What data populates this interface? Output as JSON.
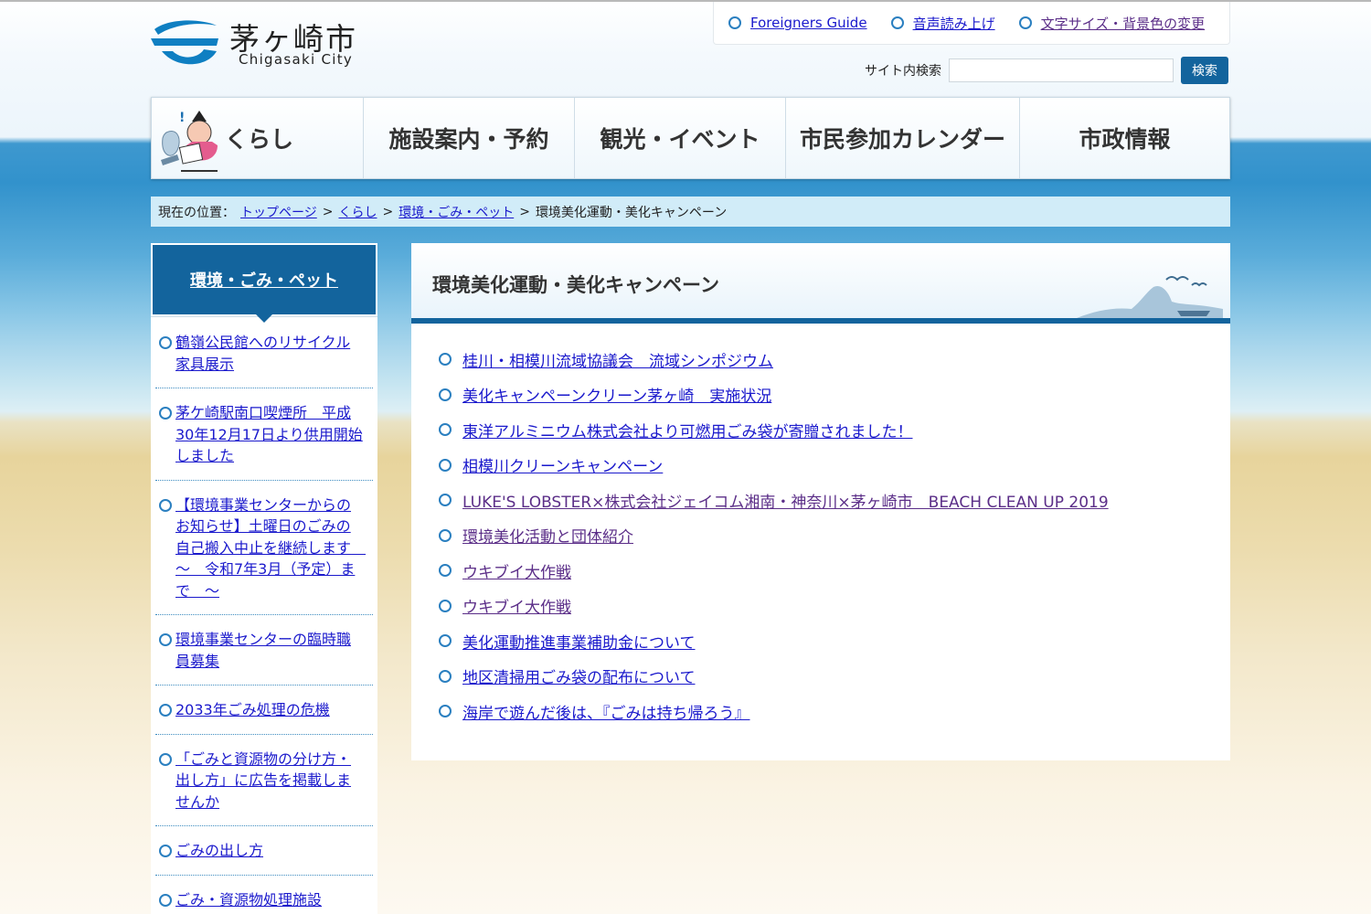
{
  "header": {
    "city_name_ja": "茅ヶ崎市",
    "city_name_en": "Chigasaki City",
    "utility_links": [
      {
        "label": "Foreigners Guide"
      },
      {
        "label": "音声読み上げ"
      },
      {
        "label": "文字サイズ・背景色の変更"
      }
    ],
    "search": {
      "label": "サイト内検索",
      "value": "",
      "button": "検索"
    }
  },
  "nav": {
    "items": [
      {
        "label": "くらし"
      },
      {
        "label": "施設案内・予約"
      },
      {
        "label": "観光・イベント"
      },
      {
        "label": "市民参加カレンダー"
      },
      {
        "label": "市政情報"
      }
    ]
  },
  "breadcrumb": {
    "prefix": "現在の位置：",
    "separator": ">",
    "links": [
      "トップページ",
      "くらし",
      "環境・ごみ・ペット"
    ],
    "current": "環境美化運動・美化キャンペーン"
  },
  "sidebar": {
    "heading": "環境・ごみ・ペット",
    "items": [
      {
        "label": "鶴嶺公民館へのリサイクル家具展示"
      },
      {
        "label": "茅ケ崎駅南口喫煙所　平成30年12月17日より供用開始しました"
      },
      {
        "label": "【環境事業センターからのお知らせ】土曜日のごみの自己搬入中止を継続します　～　令和7年3月（予定）まで　～"
      },
      {
        "label": "環境事業センターの臨時職員募集"
      },
      {
        "label": "2033年ごみ処理の危機"
      },
      {
        "label": "「ごみと資源物の分け方・出し方」に広告を掲載しませんか"
      },
      {
        "label": "ごみの出し方"
      },
      {
        "label": "ごみ・資源物処理施設"
      }
    ]
  },
  "main": {
    "title": "環境美化運動・美化キャンペーン",
    "links": [
      {
        "label": "桂川・相模川流域協議会　流域シンポジウム",
        "visited": false
      },
      {
        "label": "美化キャンペーンクリーン茅ヶ崎　実施状況",
        "visited": false
      },
      {
        "label": "東洋アルミニウム株式会社より可燃用ごみ袋が寄贈されました！",
        "visited": false
      },
      {
        "label": "相模川クリーンキャンペーン",
        "visited": false
      },
      {
        "label": "LUKE'S LOBSTER×株式会社ジェイコム湘南・神奈川×茅ヶ崎市　BEACH CLEAN UP 2019",
        "visited": true
      },
      {
        "label": "環境美化活動と団体紹介",
        "visited": true
      },
      {
        "label": "ウキブイ大作戦",
        "visited": true
      },
      {
        "label": "ウキブイ大作戦",
        "visited": true
      },
      {
        "label": "美化運動推進事業補助金について",
        "visited": false
      },
      {
        "label": "地区清掃用ごみ袋の配布について",
        "visited": false
      },
      {
        "label": "海岸で遊んだ後は、『ごみは持ち帰ろう』",
        "visited": false
      }
    ]
  },
  "colors": {
    "brand": "#13649d",
    "link": "#1a19cc",
    "visited_link": "#5b2e88",
    "breadcrumb_bg": "#d1ecf8",
    "bullet_ring": "#2a7fc0"
  },
  "icons": {
    "logo": "chigasaki-wave-logo",
    "bullet": "ring-bullet-icon",
    "mascot": "mascot-reading-icon",
    "decoration": "seagull-island-icon"
  }
}
